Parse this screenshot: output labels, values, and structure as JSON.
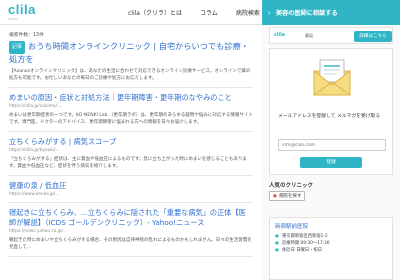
{
  "header": {
    "logo": "clila",
    "logo_sub": "MEDIA",
    "nav": [
      "clila（クリラ）とは",
      "コラム",
      "病院検索"
    ],
    "cta": {
      "arrow": "›",
      "label": "美容の医師に相談する"
    }
  },
  "main": {
    "count_label": "検索件数：13件",
    "results": [
      {
        "pill": "記事",
        "title": "おうち時間オンラインクリニック | 自宅からいつでも診療・処方を",
        "url": "",
        "desc": "【Axanosオンラインクリニック】は、あなたの生活に合わせて対応できるオンライン診療サービス。オンラインで薬の処方も可能です。お忙しいあなたの毎日のご診療や処方にお応えします。"
      },
      {
        "pill": "",
        "title": "めまいの原因・症状と対処方法｜更年期障害・更年期のなやみのこと",
        "url": "https://clila.jp/column/...",
        "desc": "めまいは更年期症状の一つです。KO-NENKI Lab.（更年期ラボ）は、更年期のあらゆる疑問や悩みに対応する情報サイトです。専門医、ドクターのアドバイス、更年期障害に悩まれる方への情報を日々お届けします。"
      },
      {
        "pill": "",
        "title": "立ちくらみがする | 病気スコープ",
        "url": "https://clila.jp/byouki/...",
        "desc": "「立ちくらみがする」症状は、主に貧血や低血圧によるものです。急に立ち上がった時にめまいを感じることもあります。貧血や低血圧など、症状を伴う病気を紹介します。"
      },
      {
        "pill": "",
        "title": "健康の泉 / 低血圧",
        "url": "https://www.kenko.jp/...",
        "desc": ""
      },
      {
        "pill": "",
        "title": "寝起きに立ちくらみ、...立ちくらみに隠された「重要な病気」の正体【医師が解説】（ICDS ゴールデンクリニック）- Yahoo!ニュース",
        "url": "https://news.yahoo.co.jp/...",
        "desc": "朝起きた時にめまいや立ちくらみがする場合、その原因は自律神経の乱れによるものかもしれません。日々の生活習慣を見直して..."
      }
    ]
  },
  "sidebar": {
    "ad": {
      "logo": "clila",
      "pharmacy": "薬局",
      "button": "詳細はこちら"
    },
    "mail": {
      "caption": "メールアドレスを登録して メルマガを受け取る",
      "placeholder": "info@clila.com",
      "button": "登録"
    },
    "popular": {
      "title": "人気のクリニック",
      "tag": "病院を探す"
    },
    "clinic": {
      "name": "新宿駅前医院",
      "rows": [
        {
          "icon": "●",
          "text": "東京都新宿区西新宿1-2"
        },
        {
          "icon": "●",
          "text": "診療時間 09:30〜17:30"
        },
        {
          "icon": "●",
          "text": "休診日 日曜日・祝日"
        }
      ]
    }
  },
  "colors": {
    "accent": "#2fb5c6",
    "link": "#2f6fd0"
  }
}
